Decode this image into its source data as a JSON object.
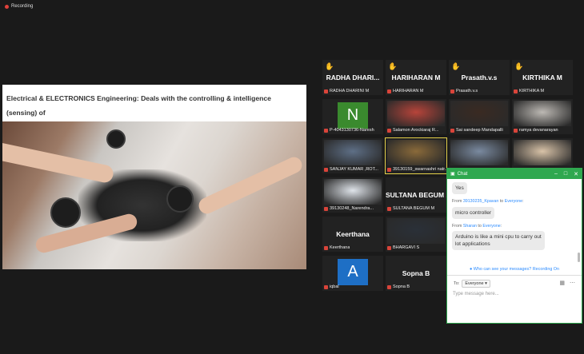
{
  "recording": {
    "label": "Recording"
  },
  "share": {
    "title": "Electrical & ELECTRONICS Engineering: Deals with the controlling & intelligence (sensing)  of"
  },
  "participants": [
    {
      "id": "radha",
      "big_name": "RADHA  DHARI...",
      "label": "RADHA DHARINI M",
      "hand": true,
      "type": "name"
    },
    {
      "id": "hariharan",
      "big_name": "HARIHARAN M",
      "label": "HARIHARAN M",
      "hand": true,
      "type": "name"
    },
    {
      "id": "prasath",
      "big_name": "Prasath.v.s",
      "label": "Prasath.v.s",
      "hand": true,
      "type": "name"
    },
    {
      "id": "kirthika",
      "big_name": "KIRTHIKA M",
      "label": "KIRTHIKA M",
      "hand": true,
      "type": "name"
    },
    {
      "id": "naresh",
      "letter": "N",
      "label": "P-4043130736-Naresh",
      "type": "avatar",
      "color": "#3a8a2e"
    },
    {
      "id": "salamon",
      "label": "Salamon Arockiaraj R...",
      "type": "cam",
      "color": "#b7443a"
    },
    {
      "id": "saisandeep",
      "label": "Sai sandeep Mandapalli",
      "type": "cam",
      "color": "#3a2a22"
    },
    {
      "id": "ramya",
      "label": "ramya devanarayan",
      "type": "cam",
      "color": "#bdb9b4"
    },
    {
      "id": "sanjay",
      "label": "SANJAY KUMAR ,ROT...",
      "type": "cam",
      "color": "#5e6f86"
    },
    {
      "id": "swarnashri",
      "label": "39130159_swarnashri natr...",
      "type": "cam",
      "color": "#8a6a3a",
      "active": true
    },
    {
      "id": "boy1",
      "label": "",
      "type": "cam",
      "color": "#7a8aa0"
    },
    {
      "id": "girl1",
      "label": "",
      "type": "cam",
      "color": "#d9c3a8"
    },
    {
      "id": "narendra",
      "label": "39130248_Narendra...",
      "type": "cam",
      "color": "#dfe4ea"
    },
    {
      "id": "sultana",
      "big_name": "SULTANA  BEGUM ...",
      "label": "SULTANA BEGUM M",
      "type": "name"
    },
    {
      "id": "keerthana",
      "big_name": "Keerthana",
      "label": "Keerthana",
      "type": "name"
    },
    {
      "id": "bhargavi",
      "label": "BHARGAVI S",
      "type": "cam",
      "color": "#2a3038"
    },
    {
      "id": "iqbal",
      "letter": "A",
      "label": "iqbal",
      "type": "avatar",
      "color": "#1e6fc5"
    },
    {
      "id": "sopna",
      "big_name": "Sopna B",
      "label": "Sopna B",
      "type": "name"
    }
  ],
  "chat": {
    "title": "Chat",
    "messages": [
      {
        "from": "",
        "to": "",
        "text": "Yes"
      },
      {
        "from": "39130235_Kpavan",
        "to": "Everyone",
        "text": "micro controller"
      },
      {
        "from": "Sharan",
        "to": "Everyone",
        "text": "Arduino is like a mini cpu to carry out lot applications"
      }
    ],
    "from_word": "From",
    "to_word": "to",
    "notice": "Who can see your messages? Recording On",
    "to_label": "To:",
    "recipient": "Everyone",
    "placeholder": "Type message here..."
  }
}
